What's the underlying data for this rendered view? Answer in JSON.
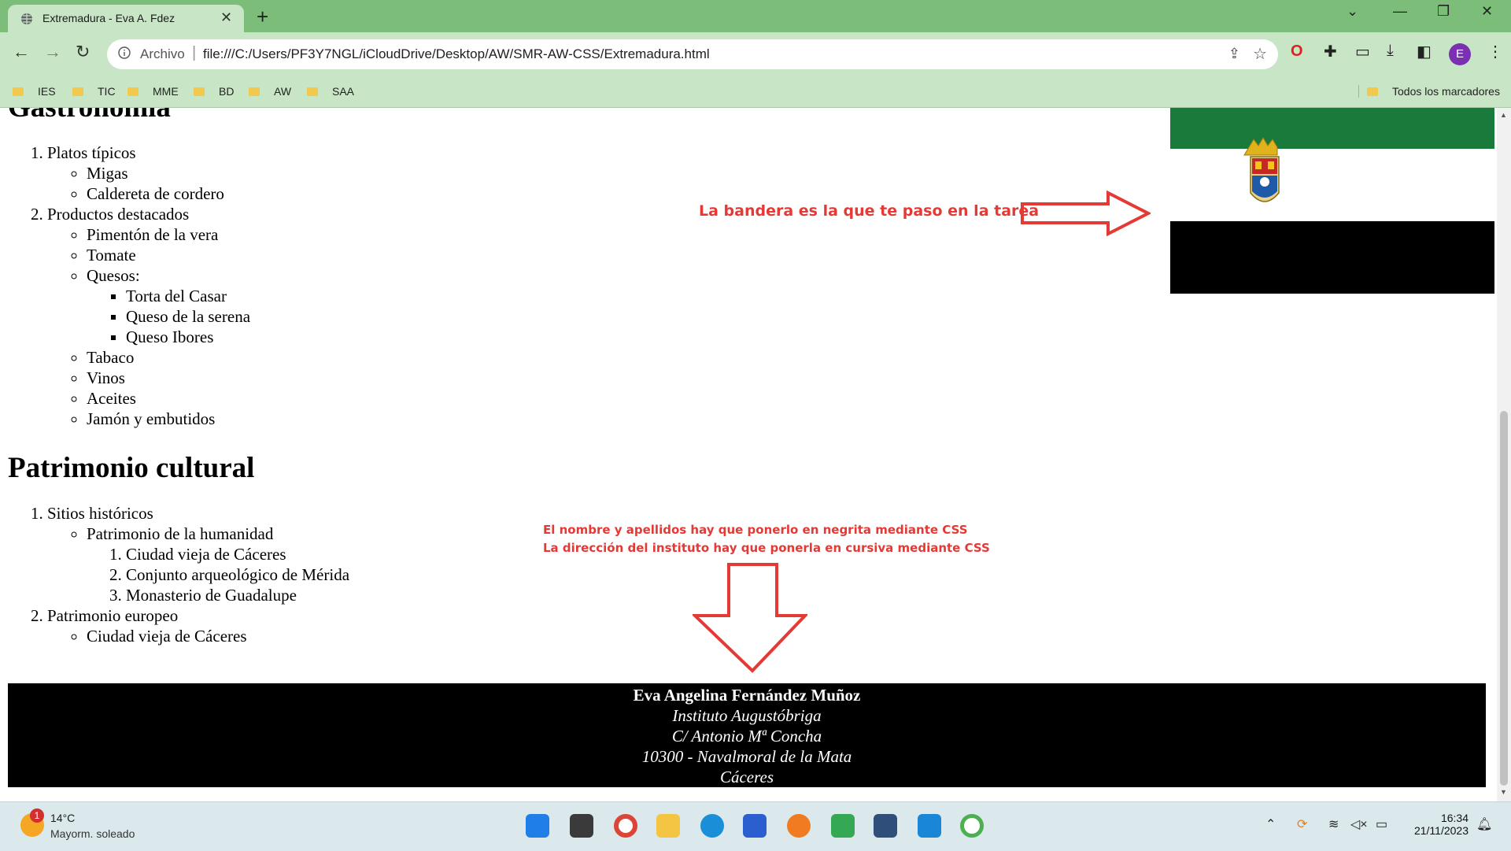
{
  "browser": {
    "tab_title": "Extremadura - Eva A. Fdez",
    "new_tab": "+",
    "url_scheme": "Archivo",
    "url": "file:///C:/Users/PF3Y7NGL/iCloudDrive/Desktop/AW/SMR-AW-CSS/Extremadura.html",
    "profile_initial": "E",
    "bookmarks": [
      "IES",
      "TIC",
      "MME",
      "BD",
      "AW",
      "SAA"
    ],
    "all_bookmarks": "Todos los marcadores"
  },
  "page": {
    "gastronomia": {
      "heading": "Gastronomía",
      "items": [
        {
          "label": "Platos típicos",
          "sub": [
            "Migas",
            "Caldereta de cordero"
          ]
        },
        {
          "label": "Productos destacados",
          "sub_before": [
            "Pimentón de la vera",
            "Tomate"
          ],
          "quesos_label": "Quesos:",
          "quesos": [
            "Torta del Casar",
            "Queso de la serena",
            "Queso Ibores"
          ],
          "sub_after": [
            "Tabaco",
            "Vinos",
            "Aceites",
            "Jamón y embutidos"
          ]
        }
      ]
    },
    "patrimonio": {
      "heading": "Patrimonio cultural",
      "items": [
        {
          "label": "Sitios históricos",
          "sub_label": "Patrimonio de la humanidad",
          "sub_items": [
            "Ciudad vieja de Cáceres",
            "Conjunto arqueológico de Mérida",
            "Monasterio de Guadalupe"
          ]
        },
        {
          "label": "Patrimonio europeo",
          "sub": [
            "Ciudad vieja de Cáceres"
          ]
        }
      ]
    },
    "notes": {
      "flag_note": "La bandera es la que te paso en la tarea",
      "css_note_1": "El nombre y apellidos hay que ponerlo en negrita mediante CSS",
      "css_note_2": "La dirección del instituto hay que ponerla en cursiva mediante CSS"
    },
    "footer": {
      "name": "Eva Angelina Fernández Muñoz",
      "institute": "Instituto Augustóbriga",
      "street": "C/ Antonio Mª Concha",
      "city": "10300 - Navalmoral de la Mata",
      "province": "Cáceres"
    },
    "colors": {
      "flag_green": "#1a7a3c",
      "flag_white": "#ffffff",
      "flag_black": "#000000",
      "annotation_red": "#e53935"
    }
  },
  "taskbar": {
    "weather_badge": "1",
    "temperature": "14°C",
    "condition": "Mayorm. soleado",
    "time": "16:34",
    "date": "21/11/2023"
  }
}
